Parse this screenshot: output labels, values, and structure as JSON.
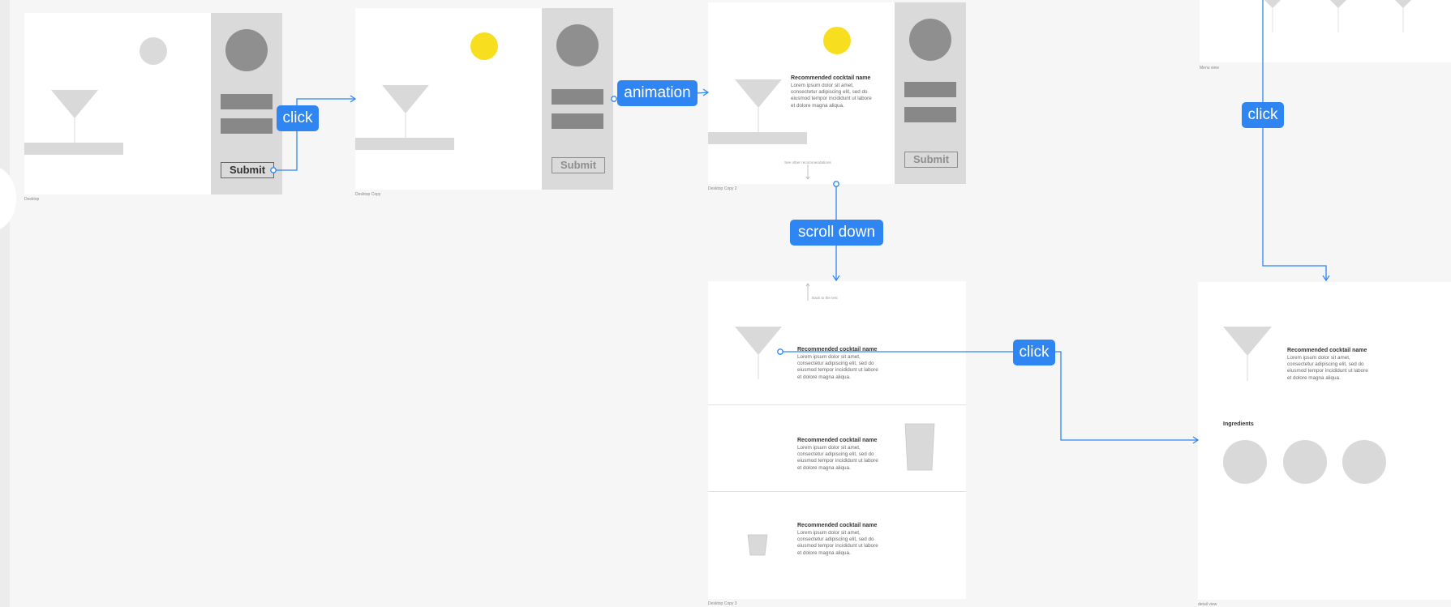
{
  "frames": {
    "desktop": {
      "label": "Desktop",
      "submit_label": "Submit"
    },
    "desktop_copy": {
      "label": "Desktop Copy",
      "submit_label": "Submit"
    },
    "desktop_copy_2": {
      "label": "Desktop Copy 2",
      "submit_label": "Submit",
      "reco_title": "Recommended cocktail name",
      "reco_body": "Lorem ipsum dolor sit amet, consectetur adipiscing elit, sed do eiusmod tempor incididunt ut labore et dolore magna aliqua.",
      "see_other": "See other recommendations"
    },
    "desktop_copy_3": {
      "label": "Desktop Copy 3",
      "back_to_top": "Back to the test",
      "items": [
        {
          "title": "Recommended cocktail name",
          "body": "Lorem ipsum dolor sit amet, consectetur adipiscing elit, sed do eiusmod tempor incididunt ut labore et dolore magna aliqua."
        },
        {
          "title": "Recommended cocktail name",
          "body": "Lorem ipsum dolor sit amet, consectetur adipiscing elit, sed do eiusmod tempor incididunt ut labore et dolore magna aliqua."
        },
        {
          "title": "Recommended cocktail name",
          "body": "Lorem ipsum dolor sit amet, consectetur adipiscing elit, sed do eiusmod tempor incididunt ut labore et dolore magna aliqua."
        }
      ]
    },
    "menu_view": {
      "label": "Menu view"
    },
    "detail_view": {
      "label": "detail view",
      "reco_title": "Recommended cocktail name",
      "reco_body": "Lorem ipsum dolor sit amet, consectetur adipiscing elit, sed do eiusmod tempor incididunt ut labore et dolore magna aliqua.",
      "ingredients_title": "Ingredients"
    }
  },
  "interactions": {
    "click_1": "click",
    "animation": "animation",
    "scroll_down": "scroll down",
    "click_2": "click",
    "click_3": "click"
  },
  "colors": {
    "canvas": "#f6f6f6",
    "frame": "#ffffff",
    "sidebar": "#dadada",
    "accent": "#2f86f2",
    "sun": "#f7de1f",
    "placeholder": "#d9d9d9"
  }
}
